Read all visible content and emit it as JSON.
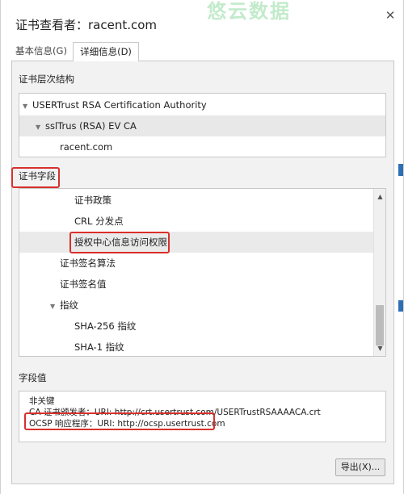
{
  "watermark": "悠云数据",
  "window": {
    "title": "证书查看者：racent.com"
  },
  "tabs": [
    {
      "label": "基本信息(G)",
      "active": false
    },
    {
      "label": "详细信息(D)",
      "active": true
    }
  ],
  "hierarchy": {
    "label": "证书层次结构",
    "items": [
      {
        "label": "USERTrust RSA Certification Authority",
        "level": 0,
        "expanded": true
      },
      {
        "label": "sslTrus (RSA) EV CA",
        "level": 1,
        "expanded": true,
        "selected": true
      },
      {
        "label": "racent.com",
        "level": 2
      }
    ]
  },
  "fields": {
    "label": "证书字段",
    "items": [
      {
        "label": "证书政策",
        "level": 2
      },
      {
        "label": "CRL 分发点",
        "level": 2
      },
      {
        "label": "授权中心信息访问权限",
        "level": 2,
        "selected": true
      },
      {
        "label": "证书签名算法",
        "level": 1
      },
      {
        "label": "证书签名值",
        "level": 1
      },
      {
        "label": "指纹",
        "level": 1,
        "expanded": true
      },
      {
        "label": "SHA-256 指纹",
        "level": 2
      },
      {
        "label": "SHA-1 指纹",
        "level": 2
      }
    ]
  },
  "field_value": {
    "label": "字段值",
    "lines": [
      "非关键",
      "CA 证书颁发者：URI: http://crt.usertrust.com/USERTrustRSAAAACA.crt",
      "OCSP 响应程序：URI: http://ocsp.usertrust.com"
    ]
  },
  "buttons": {
    "export": "导出(X)..."
  },
  "colors": {
    "highlight": "#d9302c",
    "selection": "#e8e8e8"
  }
}
